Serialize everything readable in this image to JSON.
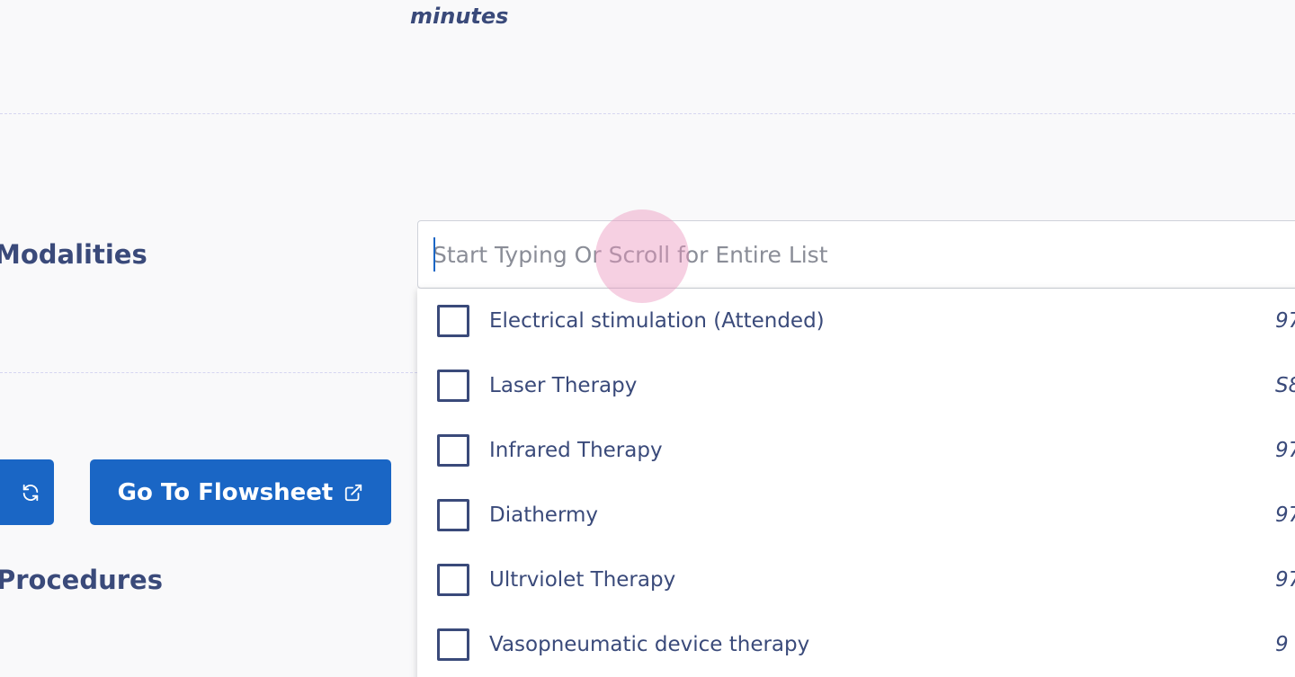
{
  "header": {
    "minutes_label": "minutes"
  },
  "sections": {
    "modalities_label": "Modalities",
    "procedures_label": "Procedures"
  },
  "buttons": {
    "refresh_icon": "refresh-icon",
    "flowsheet_label": "Go To Flowsheet",
    "flowsheet_icon": "external-link-icon"
  },
  "search": {
    "placeholder": "Start Typing Or Scroll for Entire List",
    "value": ""
  },
  "dropdown": {
    "options": [
      {
        "label": "Electrical stimulation (Attended)",
        "code": "97",
        "checked": false
      },
      {
        "label": "Laser Therapy",
        "code": "S8",
        "checked": false
      },
      {
        "label": "Infrared Therapy",
        "code": "97",
        "checked": false
      },
      {
        "label": "Diathermy",
        "code": "97",
        "checked": false
      },
      {
        "label": "Ultrviolet Therapy",
        "code": "97",
        "checked": false
      },
      {
        "label": "Vasopneumatic device therapy",
        "code": "9",
        "checked": false
      }
    ]
  },
  "colors": {
    "primary": "#1a66c5",
    "text": "#3a4a7a",
    "background": "#f9f9fa",
    "click_indicator": "#ec96be"
  }
}
